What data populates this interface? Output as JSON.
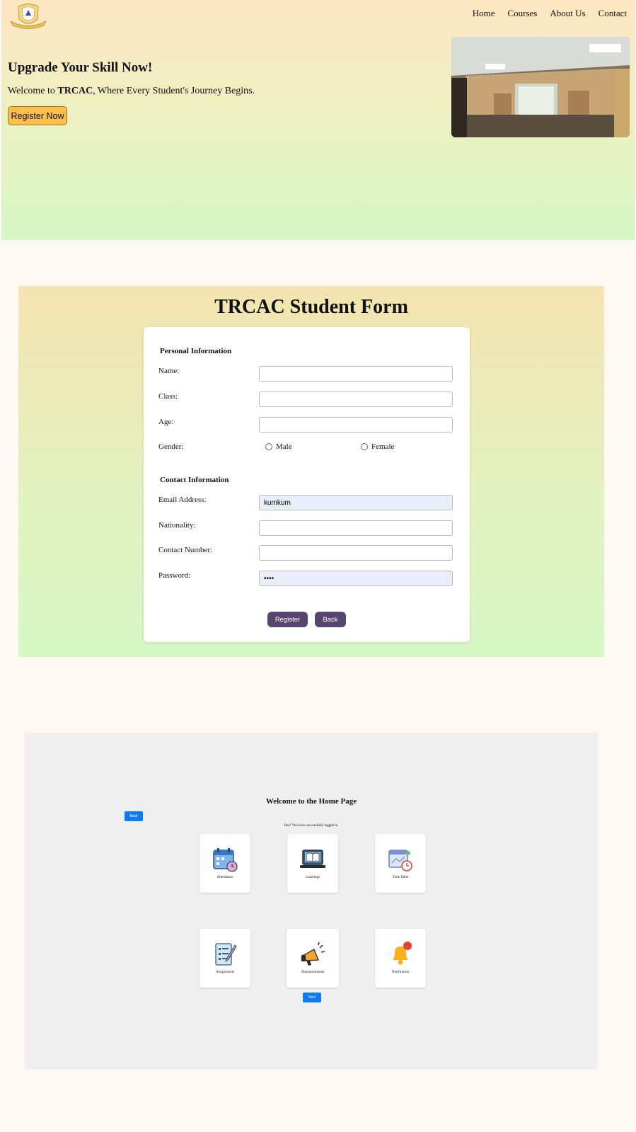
{
  "nav": {
    "items": [
      "Home",
      "Courses",
      "About Us",
      "Contact"
    ]
  },
  "hero": {
    "title": "Upgrade Your Skill Now!",
    "welcome_prefix": "Welcome to ",
    "brand": "TRCAC",
    "welcome_suffix": ", Where Every Student's Journey Begins.",
    "register_button": "Register Now"
  },
  "form": {
    "title": "TRCAC Student Form",
    "personal_heading": "Personal Information",
    "labels": {
      "name": "Name:",
      "class": "Class:",
      "age": "Age:",
      "gender": "Gender:",
      "email": "Email Address:",
      "nationality": "Nationality:",
      "contact": "Contact Number:",
      "password": "Password:"
    },
    "gender_options": [
      "Male",
      "Female"
    ],
    "contact_heading": "Contact Information",
    "values": {
      "name": "",
      "class": "",
      "age": "",
      "email": "kumkum",
      "nationality": "",
      "contact": "",
      "password": "••••"
    },
    "register_button": "Register",
    "back_button": "Back"
  },
  "home": {
    "title": "Welcome to the Home Page",
    "message": "Hey! You have successfully logged in.",
    "back_button": "Back",
    "next_button": "Next",
    "tiles": [
      {
        "label": "Attendance",
        "icon": "calendar-clock-icon"
      },
      {
        "label": "Learnings",
        "icon": "laptop-book-icon"
      },
      {
        "label": "Time Table",
        "icon": "schedule-icon"
      },
      {
        "label": "Assignments",
        "icon": "checklist-icon"
      },
      {
        "label": "Announcements",
        "icon": "megaphone-icon"
      },
      {
        "label": "Notification",
        "icon": "bell-icon"
      }
    ]
  },
  "colors": {
    "accent_button": "#fbbf4b",
    "form_button": "#57466f",
    "blue_button": "#0d7cf2"
  }
}
